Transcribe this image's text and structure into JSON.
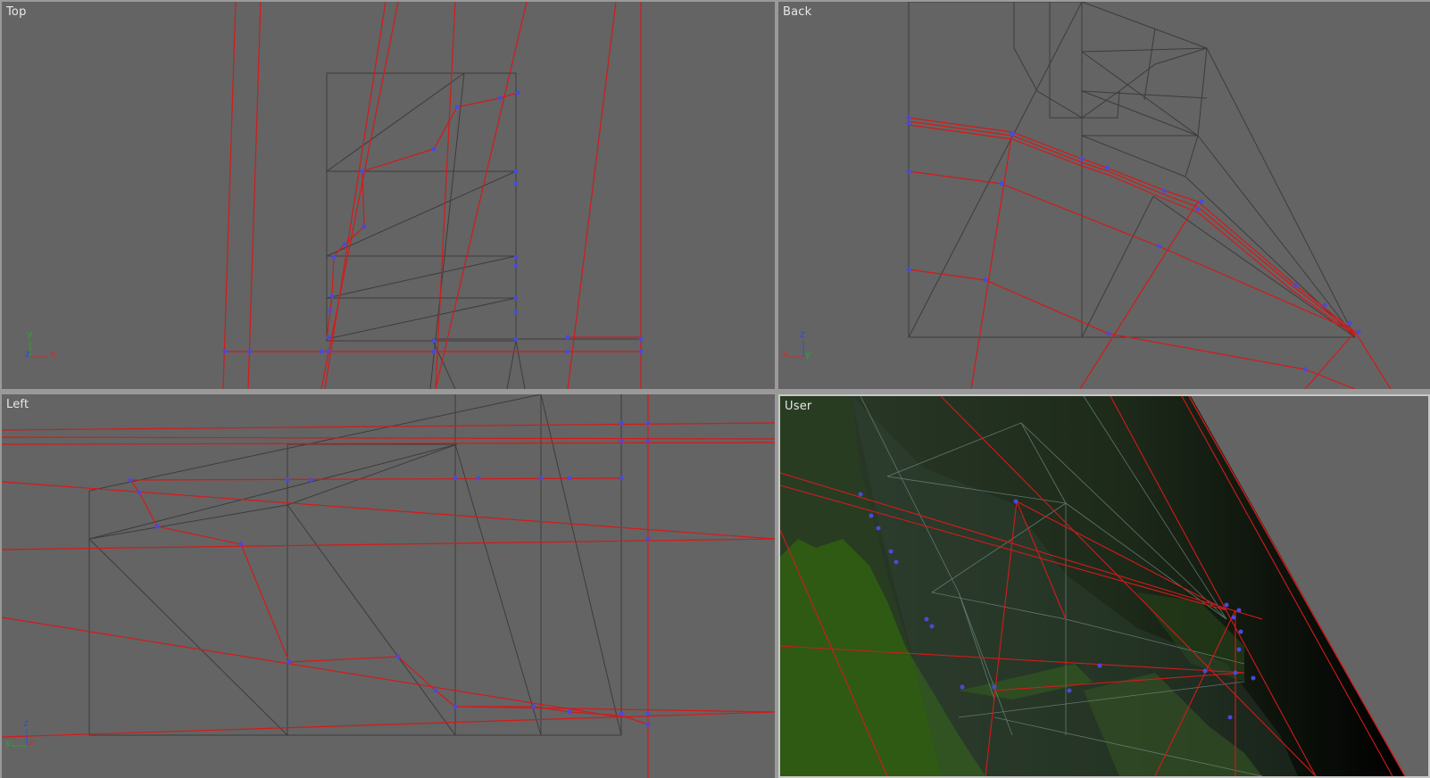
{
  "viewports": {
    "top": {
      "label": "Top",
      "axes": {
        "up": "y",
        "right": "x",
        "out": "z"
      }
    },
    "back": {
      "label": "Back",
      "axes": {
        "up": "z",
        "right": "y",
        "left": "x"
      }
    },
    "left": {
      "label": "Left",
      "axes": {
        "up": "z",
        "right": "x",
        "left": "y"
      }
    },
    "user": {
      "label": "User"
    }
  },
  "colors": {
    "viewport_bg": "#646464",
    "separator": "#9a9a9a",
    "edge_red": "#d41a1a",
    "mesh_dark": "#3c3c3c",
    "vertex_blue": "#4a4ad8",
    "axis_x": "#c83030",
    "axis_y": "#30a030",
    "axis_z": "#3050c8",
    "foliage_green": "#2e5a14",
    "active_border": "#c8c8c8"
  }
}
